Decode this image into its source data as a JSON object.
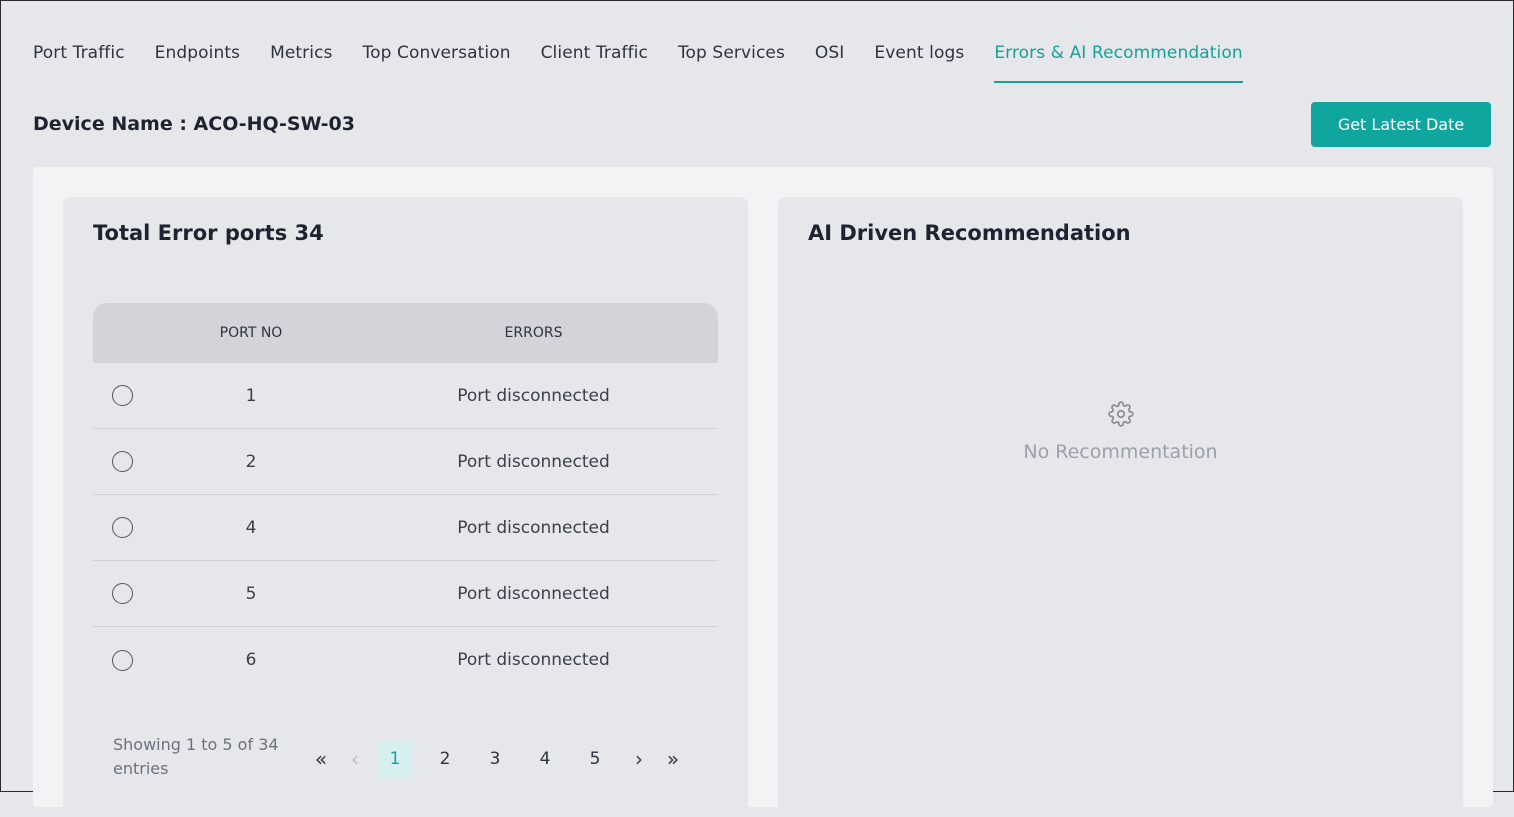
{
  "tabs": [
    {
      "label": "Port Traffic",
      "active": false
    },
    {
      "label": "Endpoints",
      "active": false
    },
    {
      "label": "Metrics",
      "active": false
    },
    {
      "label": "Top Conversation",
      "active": false
    },
    {
      "label": "Client Traffic",
      "active": false
    },
    {
      "label": "Top Services",
      "active": false
    },
    {
      "label": "OSI",
      "active": false
    },
    {
      "label": "Event logs",
      "active": false
    },
    {
      "label": "Errors & AI Recommendation",
      "active": true
    }
  ],
  "device": {
    "title": "Device Name : ACO-HQ-SW-03",
    "latest_button": "Get Latest Date"
  },
  "errors_card": {
    "title": "Total Error ports 34",
    "columns": {
      "port": "PORT NO",
      "errors": "ERRORS"
    },
    "rows": [
      {
        "port": "1",
        "error": "Port disconnected"
      },
      {
        "port": "2",
        "error": "Port disconnected"
      },
      {
        "port": "4",
        "error": "Port disconnected"
      },
      {
        "port": "5",
        "error": "Port disconnected"
      },
      {
        "port": "6",
        "error": "Port disconnected"
      }
    ],
    "pagination": {
      "info": "Showing 1 to 5 of 34 entries",
      "first": "«",
      "prev": "‹",
      "pages": [
        "1",
        "2",
        "3",
        "4",
        "5"
      ],
      "current": "1",
      "next": "›",
      "last": "»"
    }
  },
  "ai_card": {
    "title": "AI Driven Recommendation",
    "empty_icon": "gear-icon",
    "empty_text": "No Recommentation"
  },
  "colors": {
    "accent": "#16a09a",
    "button": "#10a6a0",
    "background": "#e6e7ea"
  }
}
